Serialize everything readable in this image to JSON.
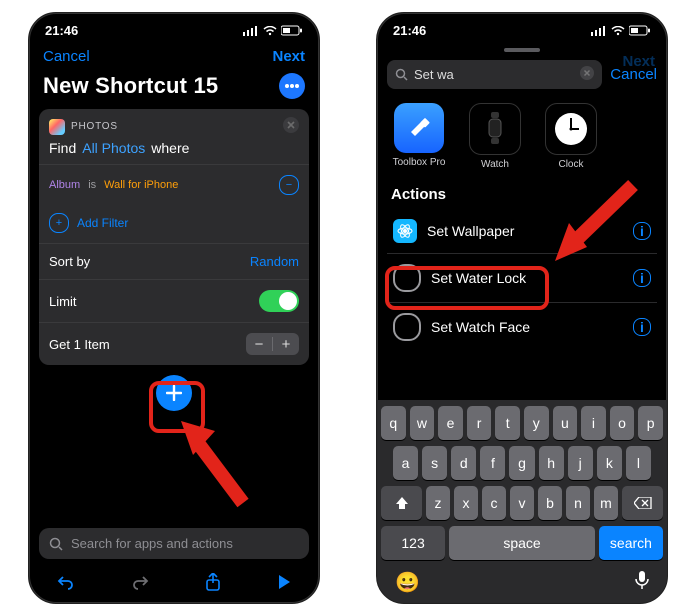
{
  "left": {
    "status_time": "21:46",
    "nav": {
      "cancel": "Cancel",
      "next": "Next"
    },
    "title": "New Shortcut 15",
    "card": {
      "app_label": "PHOTOS",
      "find_word": "Find",
      "find_scope": "All Photos",
      "find_where": "where",
      "filter": {
        "key": "Album",
        "op": "is",
        "value": "Wall for iPhone"
      },
      "add_filter": "Add Filter",
      "sort_label": "Sort by",
      "sort_value": "Random",
      "limit_label": "Limit",
      "get_label": "Get 1 Item"
    },
    "search_placeholder": "Search for apps and actions"
  },
  "right": {
    "status_time": "21:46",
    "nav_next": "Next",
    "search_value": "Set wa",
    "cancel": "Cancel",
    "apps": [
      {
        "name": "Toolbox Pro"
      },
      {
        "name": "Watch"
      },
      {
        "name": "Clock"
      }
    ],
    "section": "Actions",
    "actions": [
      {
        "label": "Set Wallpaper"
      },
      {
        "label": "Set Water Lock"
      },
      {
        "label": "Set Watch Face"
      }
    ],
    "keys_r1": [
      "q",
      "w",
      "e",
      "r",
      "t",
      "y",
      "u",
      "i",
      "o",
      "p"
    ],
    "keys_r2": [
      "a",
      "s",
      "d",
      "f",
      "g",
      "h",
      "j",
      "k",
      "l"
    ],
    "keys_r3": [
      "z",
      "x",
      "c",
      "v",
      "b",
      "n",
      "m"
    ],
    "key_123": "123",
    "key_space": "space",
    "key_search": "search"
  }
}
